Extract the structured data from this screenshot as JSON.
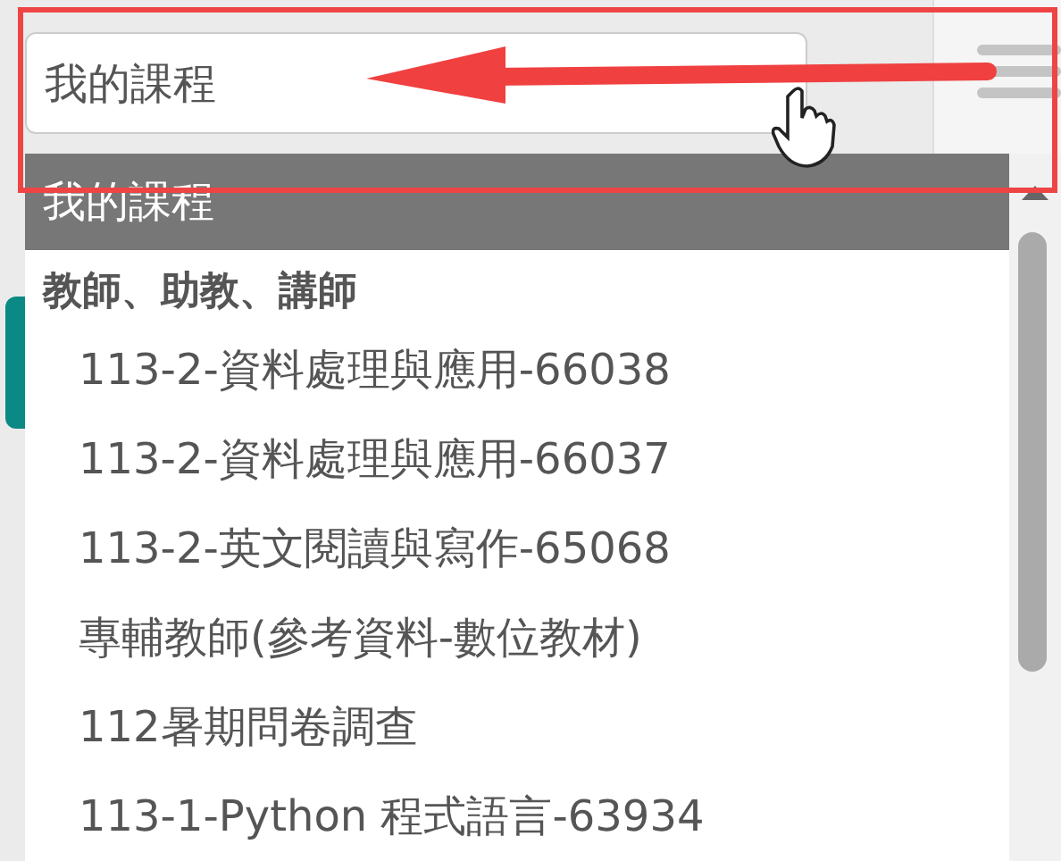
{
  "course_select": {
    "value": "我的課程"
  },
  "dropdown": {
    "options": [
      {
        "label": "我的課程",
        "selected": true
      }
    ],
    "groups": [
      {
        "label": "教師、助教、講師",
        "items": [
          {
            "label": "113-2-資料處理與應用-66038",
            "selected": false
          },
          {
            "label": "113-2-資料處理與應用-66037",
            "selected": false
          },
          {
            "label": "113-2-英文閱讀與寫作-65068",
            "selected": false
          },
          {
            "label": "專輔教師(參考資料-數位教材)",
            "selected": false
          },
          {
            "label": "112暑期問卷調查",
            "selected": false
          },
          {
            "label": "113-1-Python 程式語言-63934",
            "selected": false
          }
        ]
      }
    ]
  }
}
